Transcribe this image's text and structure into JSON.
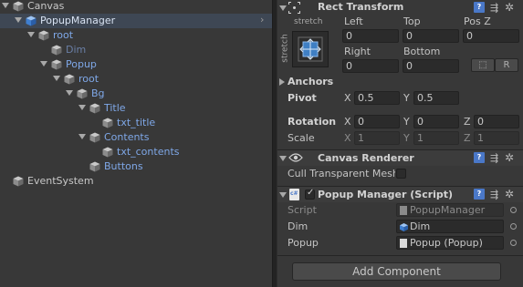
{
  "hierarchy": {
    "items": [
      {
        "label": "Canvas",
        "color_class": "c-white",
        "cube": "gray",
        "arrow": true
      },
      {
        "label": "PopupManager",
        "color_class": "c-sel",
        "cube": "blue",
        "arrow": true,
        "selected": true
      },
      {
        "label": "root",
        "color_class": "c-blue",
        "cube": "gray",
        "arrow": true
      },
      {
        "label": "Dim",
        "color_class": "c-dim",
        "cube": "gray",
        "arrow": false
      },
      {
        "label": "Popup",
        "color_class": "c-blue",
        "cube": "gray",
        "arrow": true
      },
      {
        "label": "root",
        "color_class": "c-blue",
        "cube": "gray",
        "arrow": true
      },
      {
        "label": "Bg",
        "color_class": "c-blue",
        "cube": "gray",
        "arrow": true
      },
      {
        "label": "Title",
        "color_class": "c-blue",
        "cube": "gray",
        "arrow": true
      },
      {
        "label": "txt_title",
        "color_class": "c-blue",
        "cube": "gray",
        "arrow": false
      },
      {
        "label": "Contents",
        "color_class": "c-blue",
        "cube": "gray",
        "arrow": true
      },
      {
        "label": "txt_contents",
        "color_class": "c-blue",
        "cube": "gray",
        "arrow": false
      },
      {
        "label": "Buttons",
        "color_class": "c-blue",
        "cube": "gray",
        "arrow": false
      },
      {
        "label": "EventSystem",
        "color_class": "c-white",
        "cube": "gray",
        "arrow": false
      }
    ]
  },
  "rect_transform": {
    "title": "Rect Transform",
    "stretch_top": "stretch",
    "stretch_side": "stretch",
    "left_label": "Left",
    "left_value": "0",
    "top_label": "Top",
    "top_value": "0",
    "posz_label": "Pos Z",
    "posz_value": "0",
    "right_label": "Right",
    "right_value": "0",
    "bottom_label": "Bottom",
    "bottom_value": "0",
    "r_button": "R",
    "anchors_label": "Anchors",
    "pivot_label": "Pivot",
    "pivot_x_label": "X",
    "pivot_x": "0.5",
    "pivot_y_label": "Y",
    "pivot_y": "0.5",
    "rotation_label": "Rotation",
    "rot_x_label": "X",
    "rot_x": "0",
    "rot_y_label": "Y",
    "rot_y": "0",
    "rot_z_label": "Z",
    "rot_z": "0",
    "scale_label": "Scale",
    "scale_x_label": "X",
    "scale_x": "1",
    "scale_y_label": "Y",
    "scale_y": "1",
    "scale_z_label": "Z",
    "scale_z": "1"
  },
  "canvas_renderer": {
    "title": "Canvas Renderer",
    "cull_label": "Cull Transparent Mesh"
  },
  "popup_manager": {
    "title": "Popup Manager (Script)",
    "script_label": "Script",
    "script_value": "PopupManager",
    "dim_label": "Dim",
    "dim_value": "Dim",
    "popup_label": "Popup",
    "popup_value": "Popup (Popup)"
  },
  "add_component_label": "Add Component",
  "icons": {
    "book": "help-book-icon",
    "sliders": "preset-sliders-icon",
    "gear": "settings-gear-icon"
  }
}
